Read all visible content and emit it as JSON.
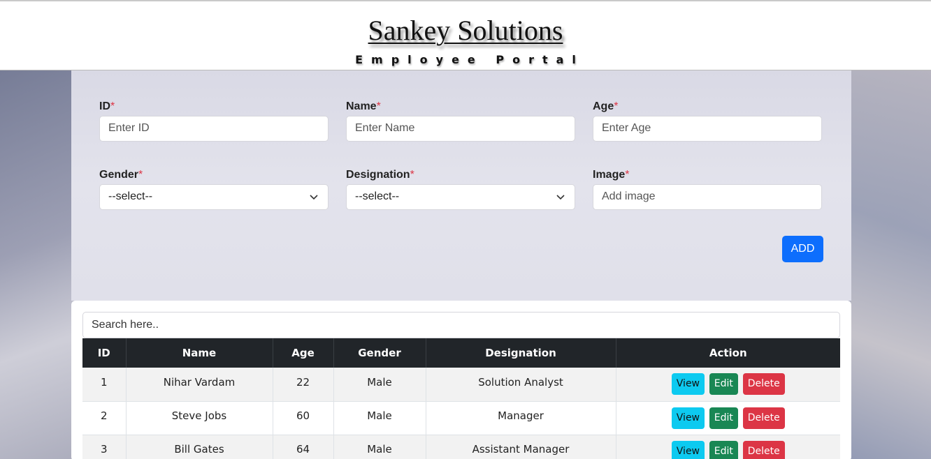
{
  "header": {
    "brand": "Sankey Solutions",
    "subtitle": "Employee Portal"
  },
  "form": {
    "id": {
      "label": "ID",
      "required": "*",
      "placeholder": "Enter ID"
    },
    "name": {
      "label": "Name",
      "required": "*",
      "placeholder": "Enter Name"
    },
    "age": {
      "label": "Age",
      "required": "*",
      "placeholder": "Enter Age"
    },
    "gender": {
      "label": "Gender",
      "required": "*",
      "selected": "--select--"
    },
    "designation": {
      "label": "Designation",
      "required": "*",
      "selected": "--select--"
    },
    "image": {
      "label": "Image",
      "required": "*",
      "placeholder": "Add image"
    },
    "add_label": "ADD"
  },
  "search": {
    "placeholder": "Search here.."
  },
  "table": {
    "columns": [
      "ID",
      "Name",
      "Age",
      "Gender",
      "Designation",
      "Action"
    ],
    "rows": [
      {
        "id": "1",
        "name": "Nihar Vardam",
        "age": "22",
        "gender": "Male",
        "designation": "Solution Analyst"
      },
      {
        "id": "2",
        "name": "Steve Jobs",
        "age": "60",
        "gender": "Male",
        "designation": "Manager"
      },
      {
        "id": "3",
        "name": "Bill Gates",
        "age": "64",
        "gender": "Male",
        "designation": "Assistant Manager"
      }
    ],
    "actions": {
      "view": "View",
      "edit": "Edit",
      "delete": "Delete"
    }
  },
  "colors": {
    "primary": "#0d6efd",
    "info": "#0dcaf0",
    "success": "#198754",
    "danger": "#dc3545",
    "table_header": "#212529"
  }
}
